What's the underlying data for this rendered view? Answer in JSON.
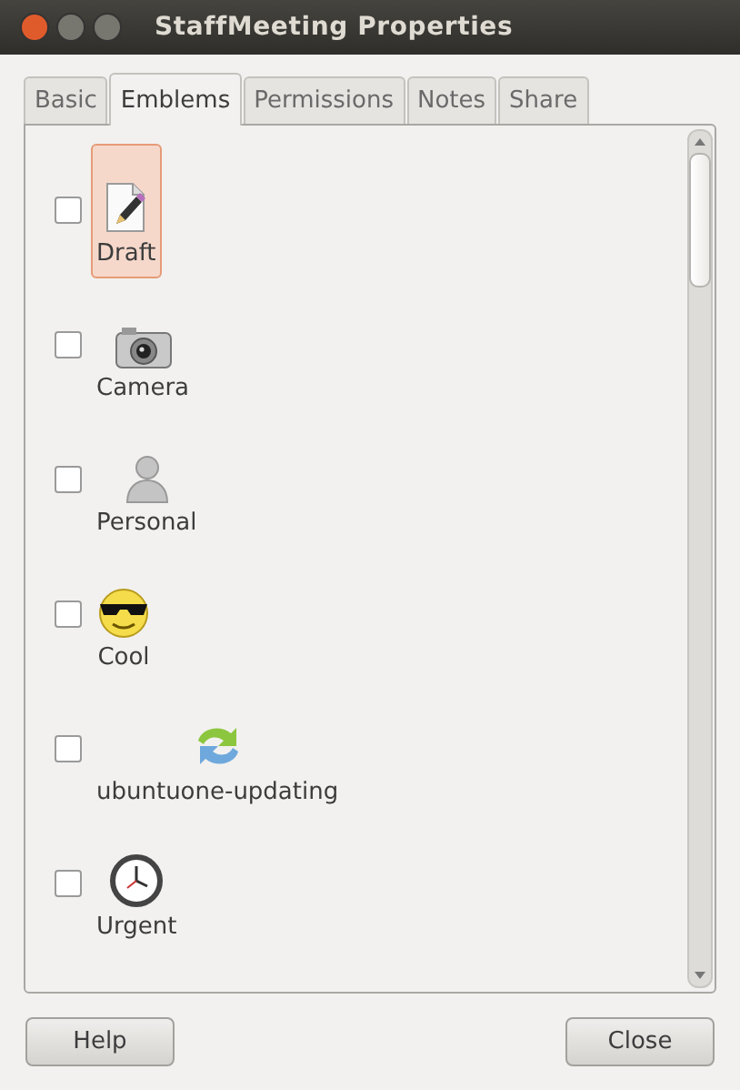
{
  "window": {
    "title": "StaffMeeting Properties"
  },
  "tabs": [
    {
      "label": "Basic",
      "selected": false
    },
    {
      "label": "Emblems",
      "selected": true
    },
    {
      "label": "Permissions",
      "selected": false
    },
    {
      "label": "Notes",
      "selected": false
    },
    {
      "label": "Share",
      "selected": false
    }
  ],
  "emblems": [
    {
      "label": "Draft",
      "checked": false,
      "selected": true
    },
    {
      "label": "Camera",
      "checked": false,
      "selected": false
    },
    {
      "label": "Personal",
      "checked": false,
      "selected": false
    },
    {
      "label": "Cool",
      "checked": false,
      "selected": false
    },
    {
      "label": "ubuntuone-updating",
      "checked": false,
      "selected": false
    },
    {
      "label": "Urgent",
      "checked": false,
      "selected": false
    }
  ],
  "buttons": [
    {
      "label": "Help"
    },
    {
      "label": "Close"
    }
  ]
}
